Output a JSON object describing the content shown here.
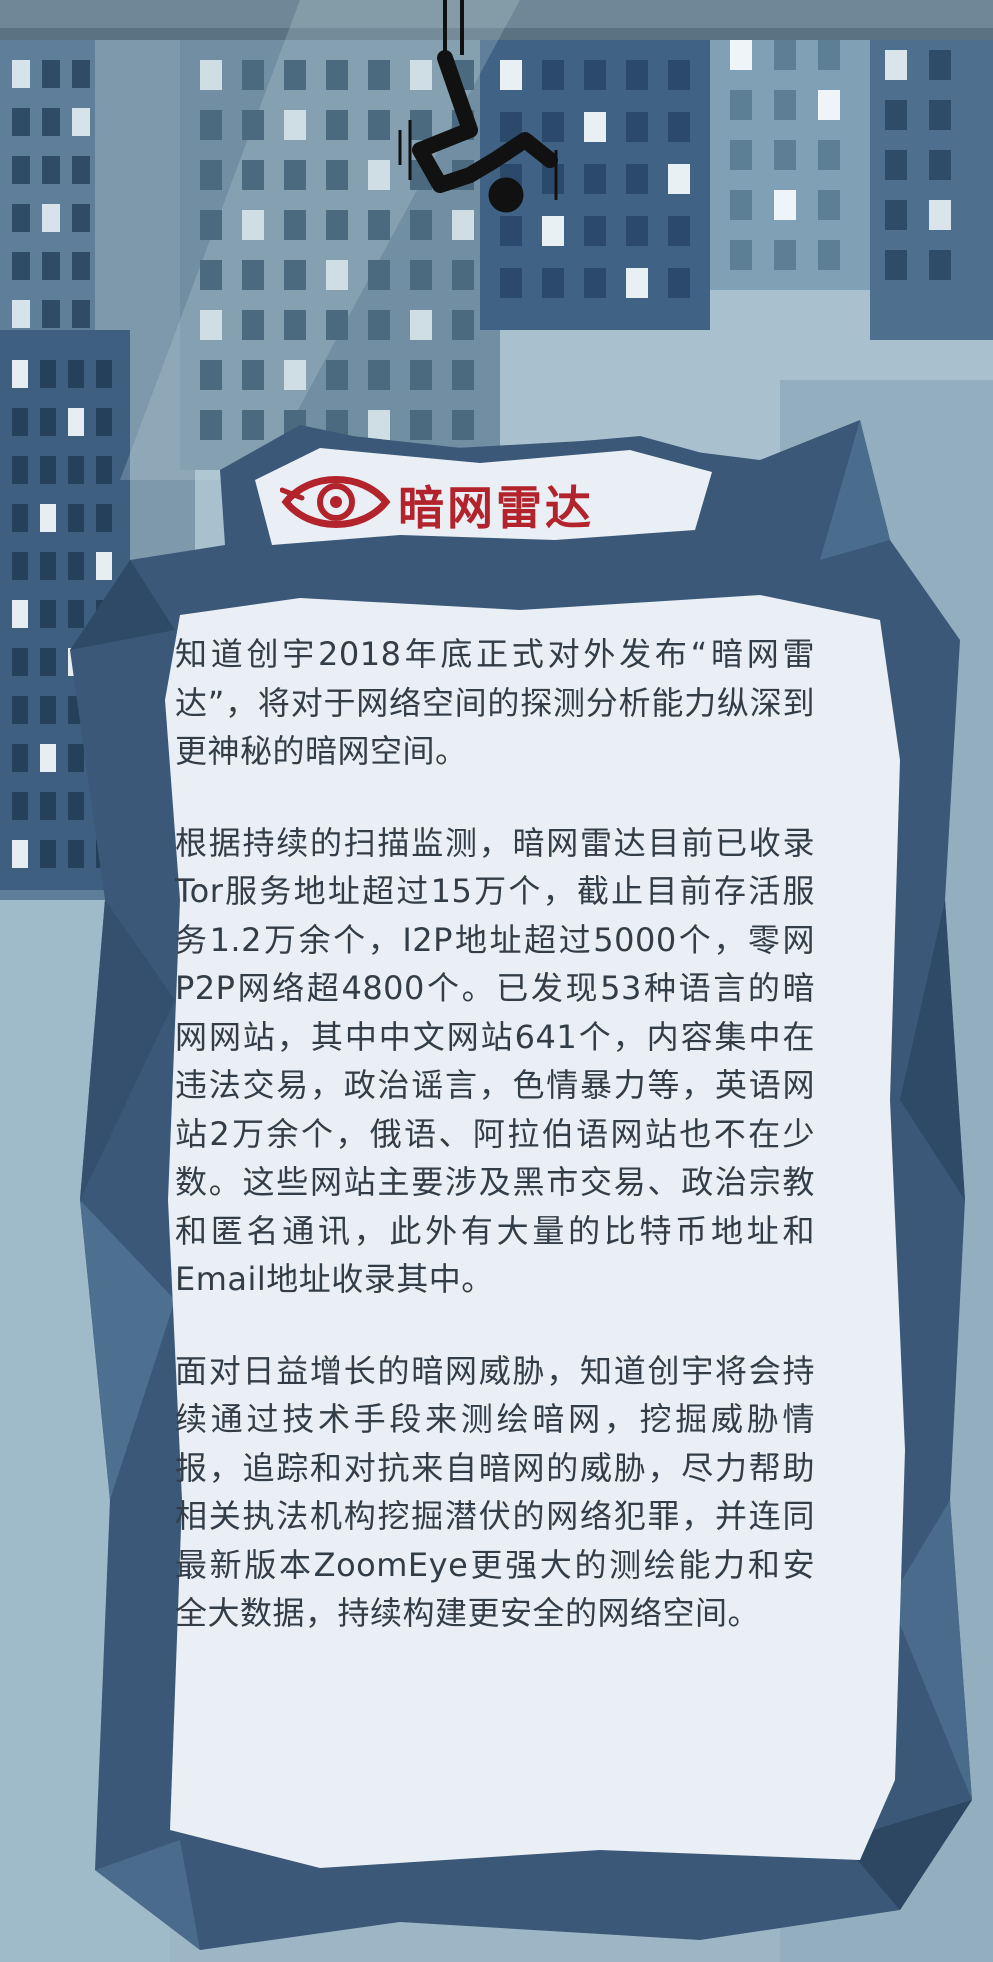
{
  "title": "暗网雷达",
  "paragraphs": [
    "知道创宇2018年底正式对外发布“暗网雷达”，将对于网络空间的探测分析能力纵深到更神秘的暗网空间。",
    "根据持续的扫描监测，暗网雷达目前已收录Tor服务地址超过15万个，截止目前存活服务1.2万余个，I2P地址超过5000个，零网P2P网络超4800个。已发现53种语言的暗网网站，其中中文网站641个，内容集中在违法交易，政治谣言，色情暴力等，英语网站2万余个，俄语、阿拉伯语网站也不在少数。这些网站主要涉及黑市交易、政治宗教和匿名通讯，此外有大量的比特币地址和Email地址收录其中。",
    "面对日益增长的暗网威胁，知道创宇将会持续通过技术手段来测绘暗网，挖掘威胁情报，追踪和对抗来自暗网的威胁，尽力帮助相关执法机构挖掘潜伏的网络犯罪，并连同最新版本ZoomEye更强大的测绘能力和安全大数据，持续构建更安全的网络空间。"
  ],
  "colors": {
    "sky": "#a9c1cf",
    "building_dark": "#3e5f80",
    "building_mid": "#7d99ab",
    "building_light": "#9fbac8",
    "frame": "#3b5878",
    "panel": "#e9eff5",
    "brand_red": "#b3232b",
    "text": "#333d47"
  },
  "icons": [
    "falling-person-icon",
    "eye-logo-icon"
  ]
}
